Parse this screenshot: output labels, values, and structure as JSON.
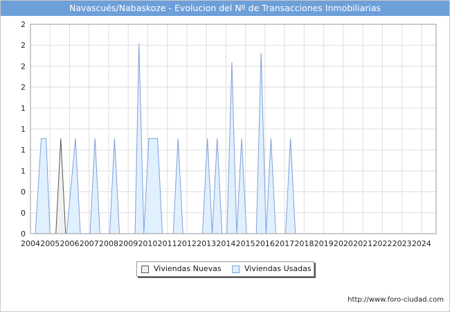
{
  "title": "Navascués/Nabaskoze - Evolucion del Nº de Transacciones Inmobiliarias",
  "footer_url": "http://www.foro-ciudad.com",
  "colors": {
    "title_bar": "#6d9fd9",
    "nuevas_fill": "#f0f0f0",
    "nuevas_line": "#555555",
    "usadas_fill": "#ddeeff",
    "usadas_line": "#7f9fd9",
    "grid": "#dddddd"
  },
  "chart_data": {
    "type": "area",
    "title": "Navascués/Nabaskoze - Evolucion del Nº de Transacciones Inmobiliarias",
    "x_tick_labels": [
      "2004",
      "2005",
      "2006",
      "2007",
      "2008",
      "2009",
      "2010",
      "2011",
      "2012",
      "2013",
      "2014",
      "2015",
      "2016",
      "2017",
      "2018",
      "2019",
      "2020",
      "2021",
      "2022",
      "2023",
      "2024"
    ],
    "y_tick_labels": [
      "0",
      "0",
      "0",
      "1",
      "1",
      "1",
      "1",
      "2",
      "2",
      "2",
      "2"
    ],
    "xlim": [
      2004.0,
      2024.75
    ],
    "ylim": [
      0,
      2.2
    ],
    "grid": true,
    "legend_position": "bottom",
    "series": [
      {
        "name": "Viviendas Nuevas",
        "points": [
          [
            2005.3,
            0
          ],
          [
            2005.55,
            1
          ],
          [
            2005.8,
            0
          ]
        ]
      },
      {
        "name": "Viviendas Usadas",
        "points": [
          [
            2004.25,
            0
          ],
          [
            2004.55,
            1
          ],
          [
            2004.8,
            1
          ],
          [
            2005.0,
            0
          ],
          [
            2005.85,
            0
          ],
          [
            2006.3,
            1
          ],
          [
            2006.55,
            0
          ],
          [
            2007.05,
            0
          ],
          [
            2007.3,
            1
          ],
          [
            2007.55,
            0
          ],
          [
            2008.05,
            0
          ],
          [
            2008.3,
            1
          ],
          [
            2008.55,
            0
          ],
          [
            2009.35,
            0
          ],
          [
            2009.55,
            2
          ],
          [
            2009.8,
            0
          ],
          [
            2009.8,
            0
          ],
          [
            2010.05,
            1
          ],
          [
            2010.5,
            1
          ],
          [
            2010.75,
            0
          ],
          [
            2011.3,
            0
          ],
          [
            2011.55,
            1
          ],
          [
            2011.8,
            0
          ],
          [
            2012.8,
            0
          ],
          [
            2013.05,
            1
          ],
          [
            2013.3,
            0
          ],
          [
            2013.3,
            0
          ],
          [
            2013.55,
            1
          ],
          [
            2013.8,
            0
          ],
          [
            2014.05,
            0
          ],
          [
            2014.3,
            1.8
          ],
          [
            2014.55,
            0
          ],
          [
            2014.55,
            0
          ],
          [
            2014.8,
            1
          ],
          [
            2015.05,
            0
          ],
          [
            2015.55,
            0
          ],
          [
            2015.8,
            1.9
          ],
          [
            2016.05,
            0
          ],
          [
            2016.05,
            0
          ],
          [
            2016.3,
            1
          ],
          [
            2016.55,
            0
          ],
          [
            2017.05,
            0
          ],
          [
            2017.3,
            1
          ],
          [
            2017.55,
            0
          ]
        ]
      }
    ]
  },
  "legend": {
    "nuevas_label": "Viviendas Nuevas",
    "usadas_label": "Viviendas Usadas"
  }
}
